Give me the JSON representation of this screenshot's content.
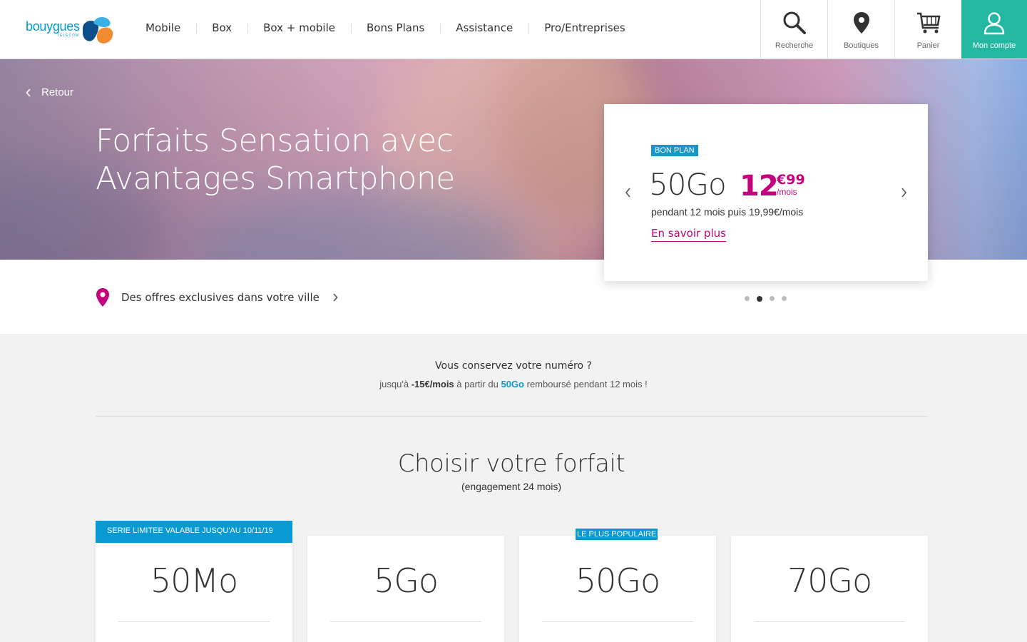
{
  "brand": {
    "name": "bouygues",
    "sub": "TELECOM"
  },
  "nav": [
    "Mobile",
    "Box",
    "Box + mobile",
    "Bons Plans",
    "Assistance",
    "Pro/Entreprises"
  ],
  "tools": {
    "search": "Recherche",
    "stores": "Boutiques",
    "cart": "Panier",
    "account": "Mon compte"
  },
  "hero": {
    "back": "Retour",
    "title": "Forfaits Sensation avec Avantages Smartphone"
  },
  "offer": {
    "badge": "BON PLAN",
    "name": "50Go",
    "price": "12",
    "cents": "€99",
    "period": "/mois",
    "detail": "pendant 12 mois puis 19,99€/mois",
    "link": "En savoir plus",
    "slides": 4,
    "active_slide": 2
  },
  "city": {
    "label": "Des offres exclusives dans votre ville"
  },
  "keep_number": {
    "title": "Vous conservez votre numéro ?",
    "line_prefix": "jusqu'à",
    "amount": "-15€/mois",
    "line_middle": "à partir du",
    "plan": "50Go",
    "line_suffix": "remboursé pendant 12 mois !"
  },
  "choose": {
    "title": "Choisir votre forfait",
    "subtitle": "(engagement 24 mois)"
  },
  "plans": [
    {
      "name": "50Mo",
      "banner": "SERIE LIMITEE VALABLE JUSQU'AU 10/11/19"
    },
    {
      "name": "5Go"
    },
    {
      "name": "50Go",
      "badge": "LE PLUS POPULAIRE"
    },
    {
      "name": "70Go"
    }
  ],
  "colors": {
    "brand_blue": "#0098d6",
    "brand_orange": "#f28b30",
    "accent_magenta": "#c2027a",
    "account_teal": "#24b8a2",
    "badge_blue": "#0a9ad3"
  }
}
